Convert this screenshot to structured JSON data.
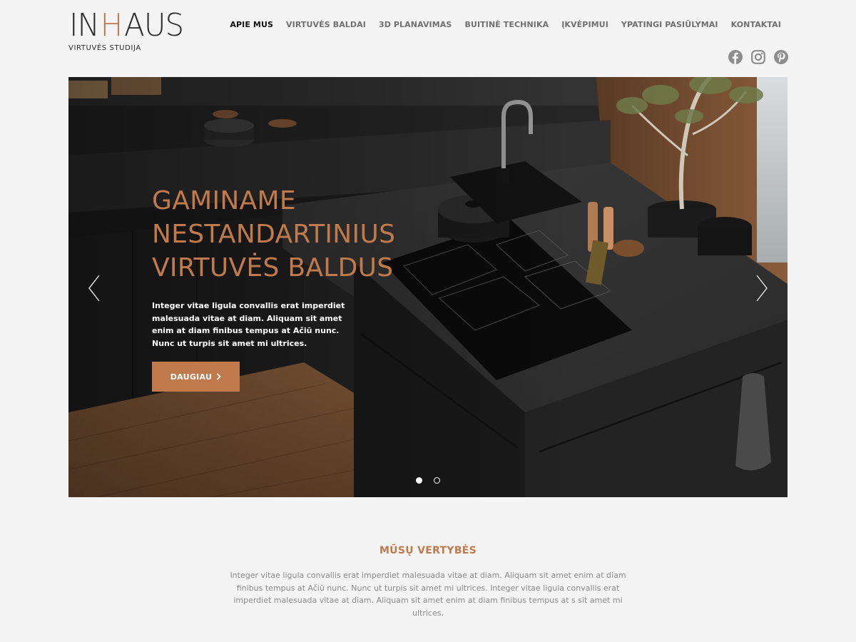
{
  "brand": {
    "logo_left": "IN",
    "logo_mid": "H",
    "logo_right": "AUS",
    "tagline": "VIRTUVĖS STUDIJA",
    "accent_color": "#c07a4b"
  },
  "nav": {
    "items": [
      {
        "label": "APIE MUS",
        "active": true
      },
      {
        "label": "VIRTUVĖS BALDAI",
        "active": false
      },
      {
        "label": "3D PLANAVIMAS",
        "active": false
      },
      {
        "label": "BUITINĖ TECHNIKA",
        "active": false
      },
      {
        "label": "ĮKVĖPIMUI",
        "active": false
      },
      {
        "label": "YPATINGI PASIŪLYMAI",
        "active": false
      },
      {
        "label": "KONTAKTAI",
        "active": false
      }
    ]
  },
  "social": {
    "icons": [
      "facebook-icon",
      "instagram-icon",
      "pinterest-icon"
    ]
  },
  "hero": {
    "title": "GAMINAME NESTANDARTINIUS VIRTUVĖS BALDUS",
    "text": "Integer vitae ligula convallis erat imperdiet malesuada vitae at diam. Aliquam sit amet enim at diam finibus tempus at Ačiū nunc. Nunc ut turpis sit amet mi ultrices.",
    "button_label": "DAUGIAU",
    "button_icon": "chevron-right-icon",
    "prev_icon": "chevron-left-icon",
    "next_icon": "chevron-right-icon",
    "slide_count": 2,
    "active_slide": 1
  },
  "values": {
    "title": "MŪSŲ VERTYBĖS",
    "text": "Integer vitae ligula convallis erat imperdiet malesuada vitae at diam. Aliquam sit amet enim at diam finibus tempus at Ačiū nunc. Nunc ut turpis sit amet mi ultrices. Integer vitae ligula convallis erat imperdiet malesuada vitae at diam. Aliquam sit amet enim at diam finibus tempus at s sit amet mi ultrices."
  }
}
